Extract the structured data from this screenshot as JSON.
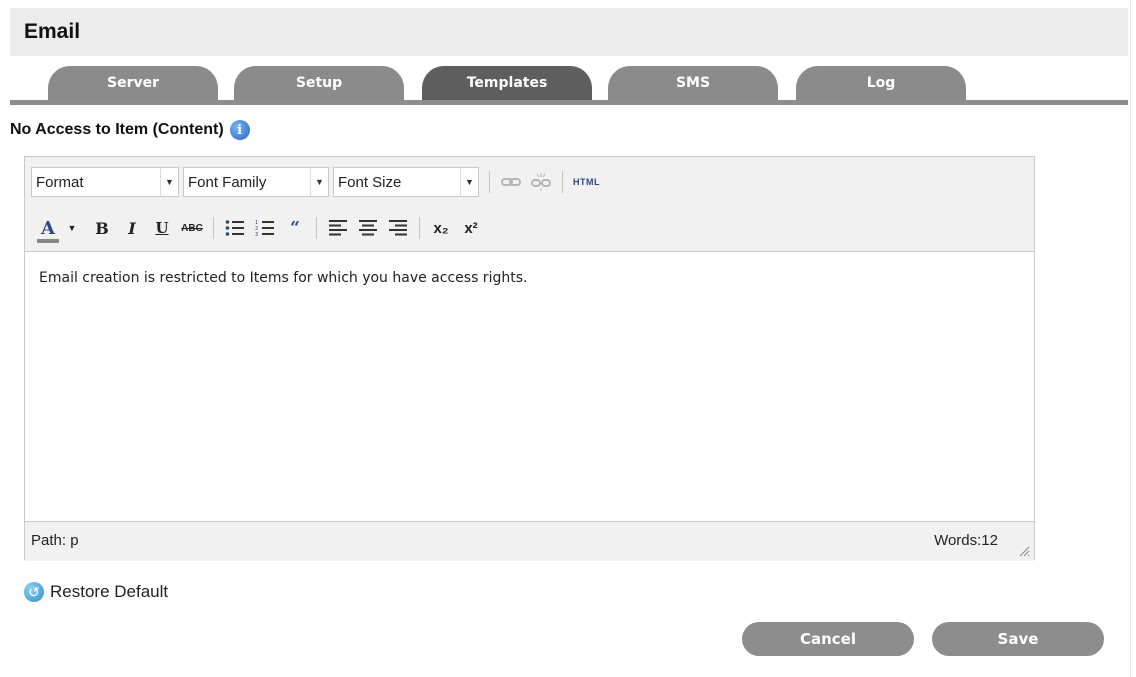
{
  "header": {
    "title": "Email"
  },
  "tabs": [
    {
      "label": "Server",
      "active": false
    },
    {
      "label": "Setup",
      "active": false
    },
    {
      "label": "Templates",
      "active": true
    },
    {
      "label": "SMS",
      "active": false
    },
    {
      "label": "Log",
      "active": false
    }
  ],
  "section": {
    "title": "No Access to Item (Content)",
    "info_icon": "info-icon"
  },
  "toolbar": {
    "format": "Format",
    "font_family": "Font Family",
    "font_size": "Font Size",
    "html_label": "HTML",
    "font_color_label": "A",
    "bold_label": "B",
    "italic_label": "I",
    "underline_label": "U",
    "strikethrough_label": "ABC",
    "subscript_label": "x₂",
    "superscript_label": "x²"
  },
  "editor": {
    "content": "Email creation is restricted to Items for which you have access rights.",
    "path": "Path: p",
    "words": "Words:12"
  },
  "restore": {
    "label": "Restore Default"
  },
  "buttons": {
    "cancel": "Cancel",
    "save": "Save"
  },
  "colors": {
    "tab": "#8b8b8b",
    "tab_active": "#5e5e5e",
    "button": "#8d8d8d",
    "header_bg": "#ececec"
  }
}
